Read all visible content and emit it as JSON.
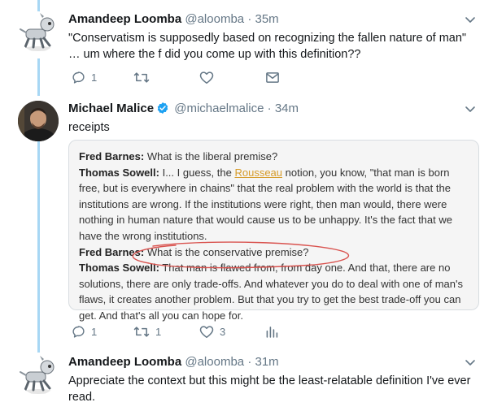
{
  "tweets": [
    {
      "author": {
        "name": "Amandeep Loomba",
        "handle": "@aloomba"
      },
      "time": "35m",
      "text": "\"Conservatism is supposedly based on recognizing the fallen nature of man\" … um where the f did you come up with this definition??",
      "actions": {
        "replies": "1",
        "retweets": "",
        "likes": ""
      }
    },
    {
      "author": {
        "name": "Michael Malice",
        "handle": "@michaelmalice",
        "verified": true
      },
      "time": "34m",
      "text": "receipts",
      "actions": {
        "replies": "1",
        "retweets": "1",
        "likes": "3"
      },
      "quote": {
        "lines": [
          {
            "speaker": "Fred Barnes:",
            "text": " What is the liberal premise?"
          },
          {
            "speaker": "Thomas Sowell:",
            "text_before": " I... I guess, the ",
            "link": "Rousseau",
            "text_after": " notion, you know, \"that man is born free, but is everywhere in chains\" that the real problem with the world is that the institutions are wrong.  If the institutions were right, then man would, there were nothing in human nature that would cause us to be unhappy.  It's the fact that we have the wrong institutions."
          },
          {
            "speaker": "Fred Barnes:",
            "text": " What is the conservative premise?"
          },
          {
            "speaker": "Thomas Sowell:",
            "highlight": " That man is flawed from, from day one.",
            "text": "  And that, there are no solutions, there are only trade-offs.  And whatever you do to deal with one of man's flaws, it creates another problem.  But that you try to get the best trade-off you can get.  And that's all you can hope for."
          }
        ]
      }
    },
    {
      "author": {
        "name": "Amandeep Loomba",
        "handle": "@aloomba"
      },
      "time": "31m",
      "text": "Appreciate the context but this might be the least-relatable definition I've ever read."
    }
  ],
  "separator": "·",
  "colors": {
    "thread_line": "#a7d7f4",
    "verified": "#1da1f2",
    "muted": "#657786",
    "link": "#d69b2a",
    "circle": "#d9534f"
  },
  "icons": [
    "reply-icon",
    "retweet-icon",
    "like-icon",
    "message-icon",
    "analytics-icon",
    "chevron-down-icon",
    "verified-badge-icon"
  ]
}
